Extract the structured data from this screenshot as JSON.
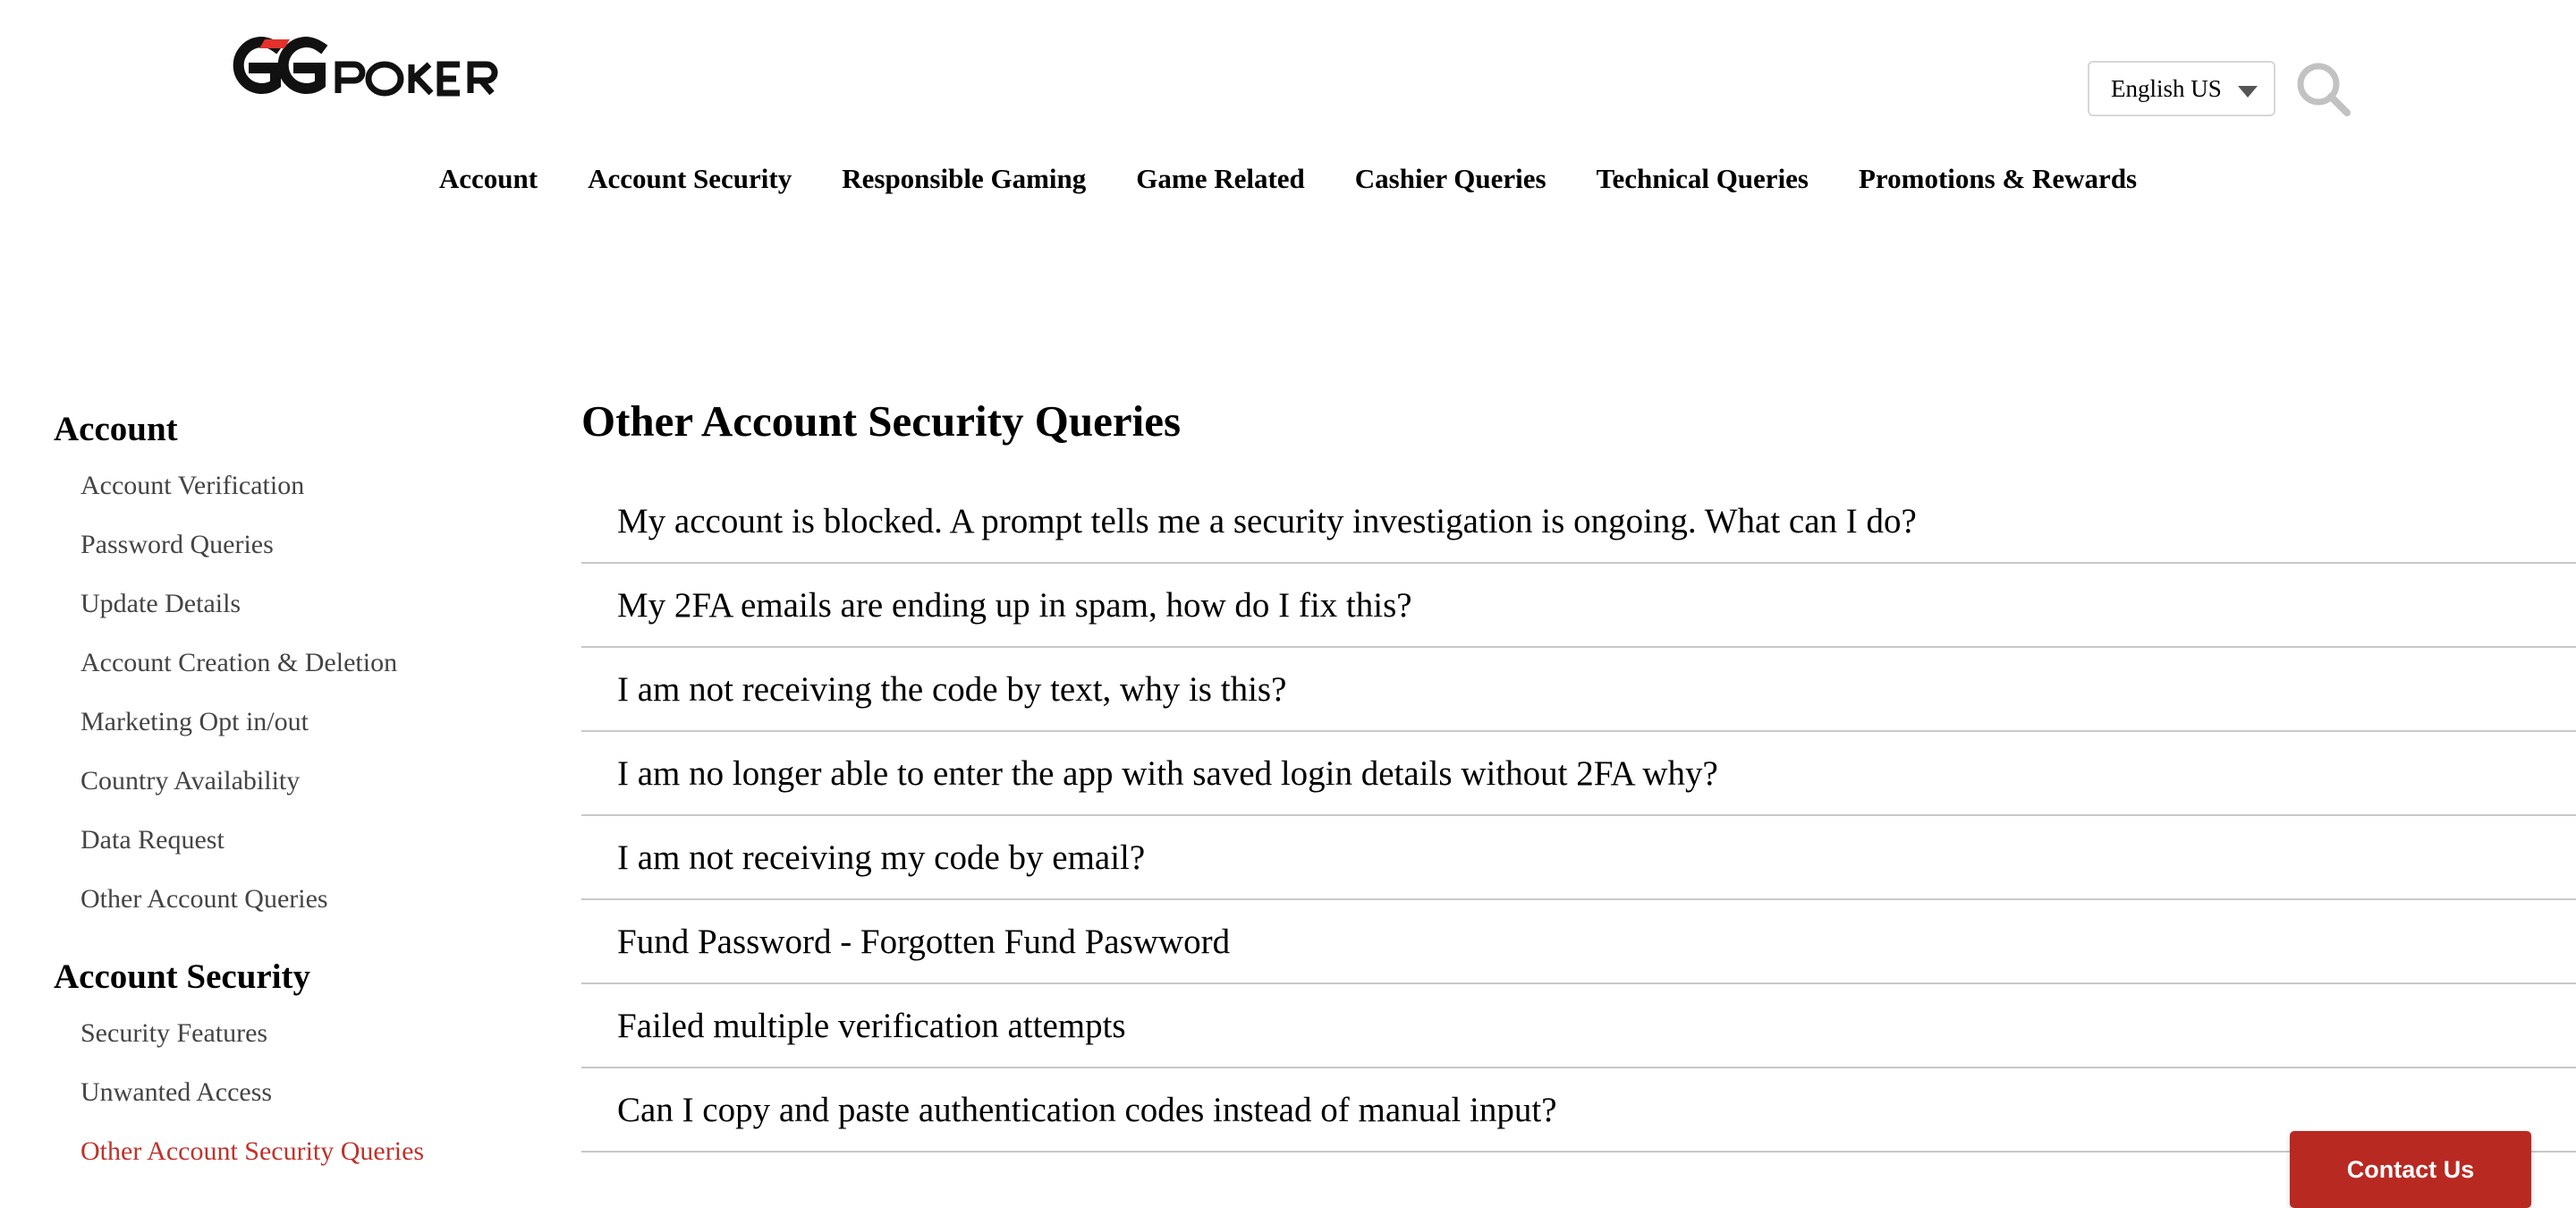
{
  "header": {
    "logo_text": "GGPOKER",
    "language": {
      "selected": "English US"
    },
    "search_icon": "search-icon"
  },
  "topnav": {
    "items": [
      {
        "label": "Account"
      },
      {
        "label": "Account Security"
      },
      {
        "label": "Responsible Gaming"
      },
      {
        "label": "Game Related"
      },
      {
        "label": "Cashier Queries"
      },
      {
        "label": "Technical Queries"
      },
      {
        "label": "Promotions & Rewards"
      }
    ]
  },
  "sidebar": {
    "groups": [
      {
        "heading": "Account",
        "items": [
          {
            "label": "Account Verification"
          },
          {
            "label": "Password Queries"
          },
          {
            "label": "Update Details"
          },
          {
            "label": "Account Creation & Deletion"
          },
          {
            "label": "Marketing Opt in/out"
          },
          {
            "label": "Country Availability"
          },
          {
            "label": "Data Request"
          },
          {
            "label": "Other Account Queries"
          }
        ]
      },
      {
        "heading": "Account Security",
        "items": [
          {
            "label": "Security Features"
          },
          {
            "label": "Unwanted Access"
          },
          {
            "label": "Other Account Security Queries",
            "active": true
          }
        ]
      }
    ]
  },
  "main": {
    "title": "Other Account Security Queries",
    "faqs": [
      {
        "question": "My account is blocked. A prompt tells me a security investigation is ongoing. What can I do?"
      },
      {
        "question": "My 2FA emails are ending up in spam, how do I fix this?"
      },
      {
        "question": "I am not receiving the code by text, why is this?"
      },
      {
        "question": "I am no longer able to enter the app with saved login details without 2FA why?"
      },
      {
        "question": "I am not receiving my code by email?"
      },
      {
        "question": "Fund Password - Forgotten Fund Paswword"
      },
      {
        "question": "Failed multiple verification attempts"
      },
      {
        "question": "Can I copy and paste authentication codes instead of manual input?"
      }
    ]
  },
  "contact": {
    "label": "Contact Us"
  },
  "colors": {
    "accent": "#c0322a",
    "contact_bg": "#b82922",
    "logo_red": "#e2322b"
  }
}
